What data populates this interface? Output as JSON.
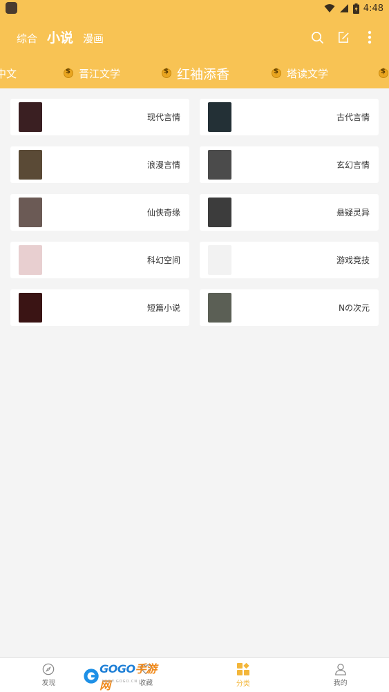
{
  "status_bar": {
    "time": "4:48"
  },
  "top_tabs": [
    {
      "label": "综合"
    },
    {
      "label": "小说"
    },
    {
      "label": "漫画"
    }
  ],
  "sources": [
    {
      "label": "中文"
    },
    {
      "label": "晋江文学"
    },
    {
      "label": "红袖添香"
    },
    {
      "label": "塔读文学"
    }
  ],
  "categories": [
    {
      "label": "现代言情",
      "thumb_color": "#3a1f22"
    },
    {
      "label": "古代言情",
      "thumb_color": "#233036"
    },
    {
      "label": "浪漫言情",
      "thumb_color": "#5a4a36"
    },
    {
      "label": "玄幻言情",
      "thumb_color": "#4b4b4b"
    },
    {
      "label": "仙侠奇缘",
      "thumb_color": "#6b5a55"
    },
    {
      "label": "悬疑灵异",
      "thumb_color": "#3c3c3c"
    },
    {
      "label": "科幻空间",
      "thumb_color": "#e8cfd0"
    },
    {
      "label": "游戏竞技",
      "thumb_color": "#f2f2f2"
    },
    {
      "label": "短篇小说",
      "thumb_color": "#3a1414"
    },
    {
      "label": "Nの次元",
      "thumb_color": "#5b5f55"
    }
  ],
  "bottom_nav": [
    {
      "label": "发现"
    },
    {
      "label": "收藏"
    },
    {
      "label": "分类"
    },
    {
      "label": "我的"
    }
  ],
  "watermark": {
    "text_latin": "GOGO",
    "text_cn": "手游网",
    "url": "WWW.GOGO.CN"
  },
  "colors": {
    "header": "#f8c354",
    "accent": "#f3b63a",
    "background": "#f4f4f4"
  }
}
